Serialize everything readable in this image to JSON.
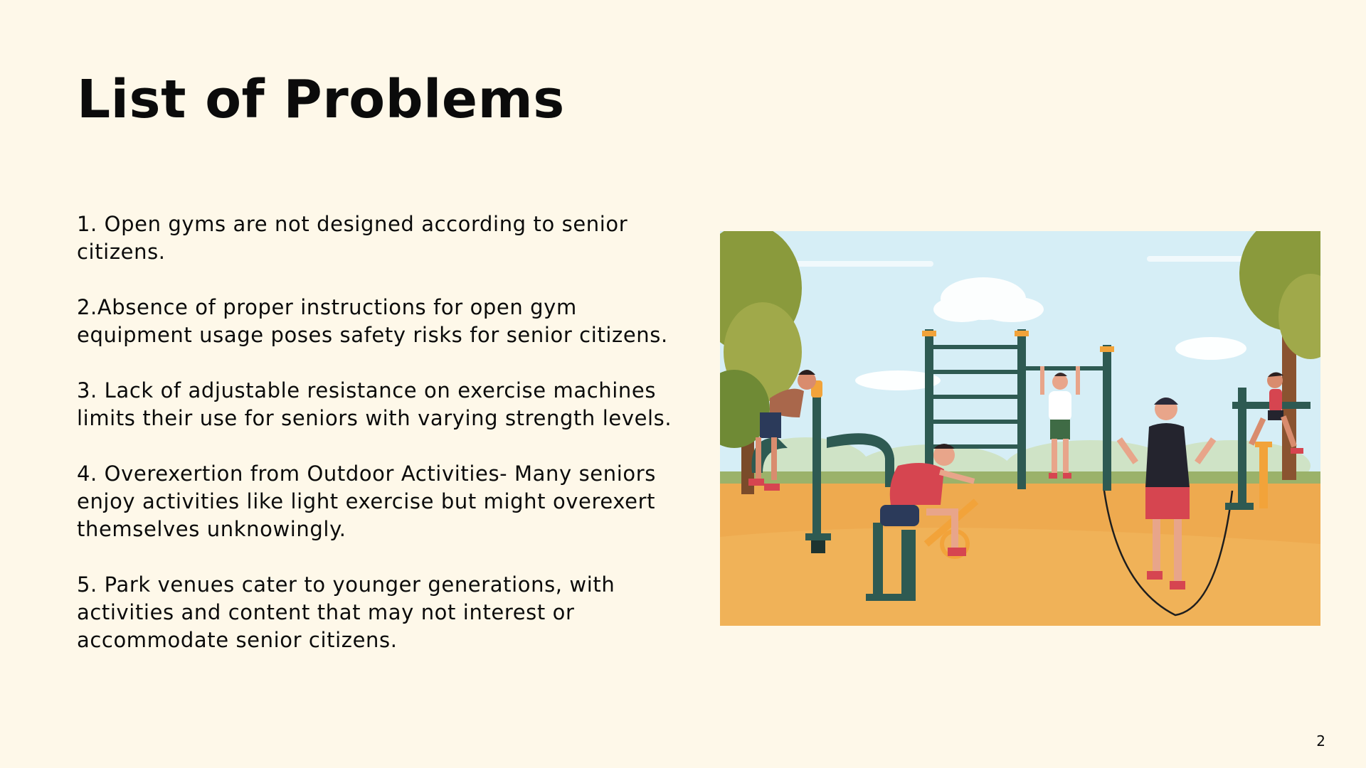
{
  "slide": {
    "title": "List of Problems",
    "page_number": "2"
  },
  "problems": [
    "1. Open gyms are not designed according to senior citizens.",
    "2.Absence of proper instructions for open gym equipment usage poses safety risks for senior citizens.",
    "3. Lack of adjustable resistance on exercise machines limits their use for seniors with varying strength levels.",
    "4. Overexertion from Outdoor Activities- Many seniors enjoy activities like light exercise but might overexert themselves unknowingly.",
    "5. Park venues cater to younger generations, with activities and content that may not interest or accommodate senior citizens."
  ],
  "illustration": {
    "icon": "outdoor-gym-illustration",
    "colors": {
      "sky": "#d6eef6",
      "ground": "#eeaa4f",
      "equipment": "#2e5a52",
      "accent": "#f2a33a",
      "shirt_red": "#d64550",
      "tree": "#8a9a3c"
    }
  }
}
